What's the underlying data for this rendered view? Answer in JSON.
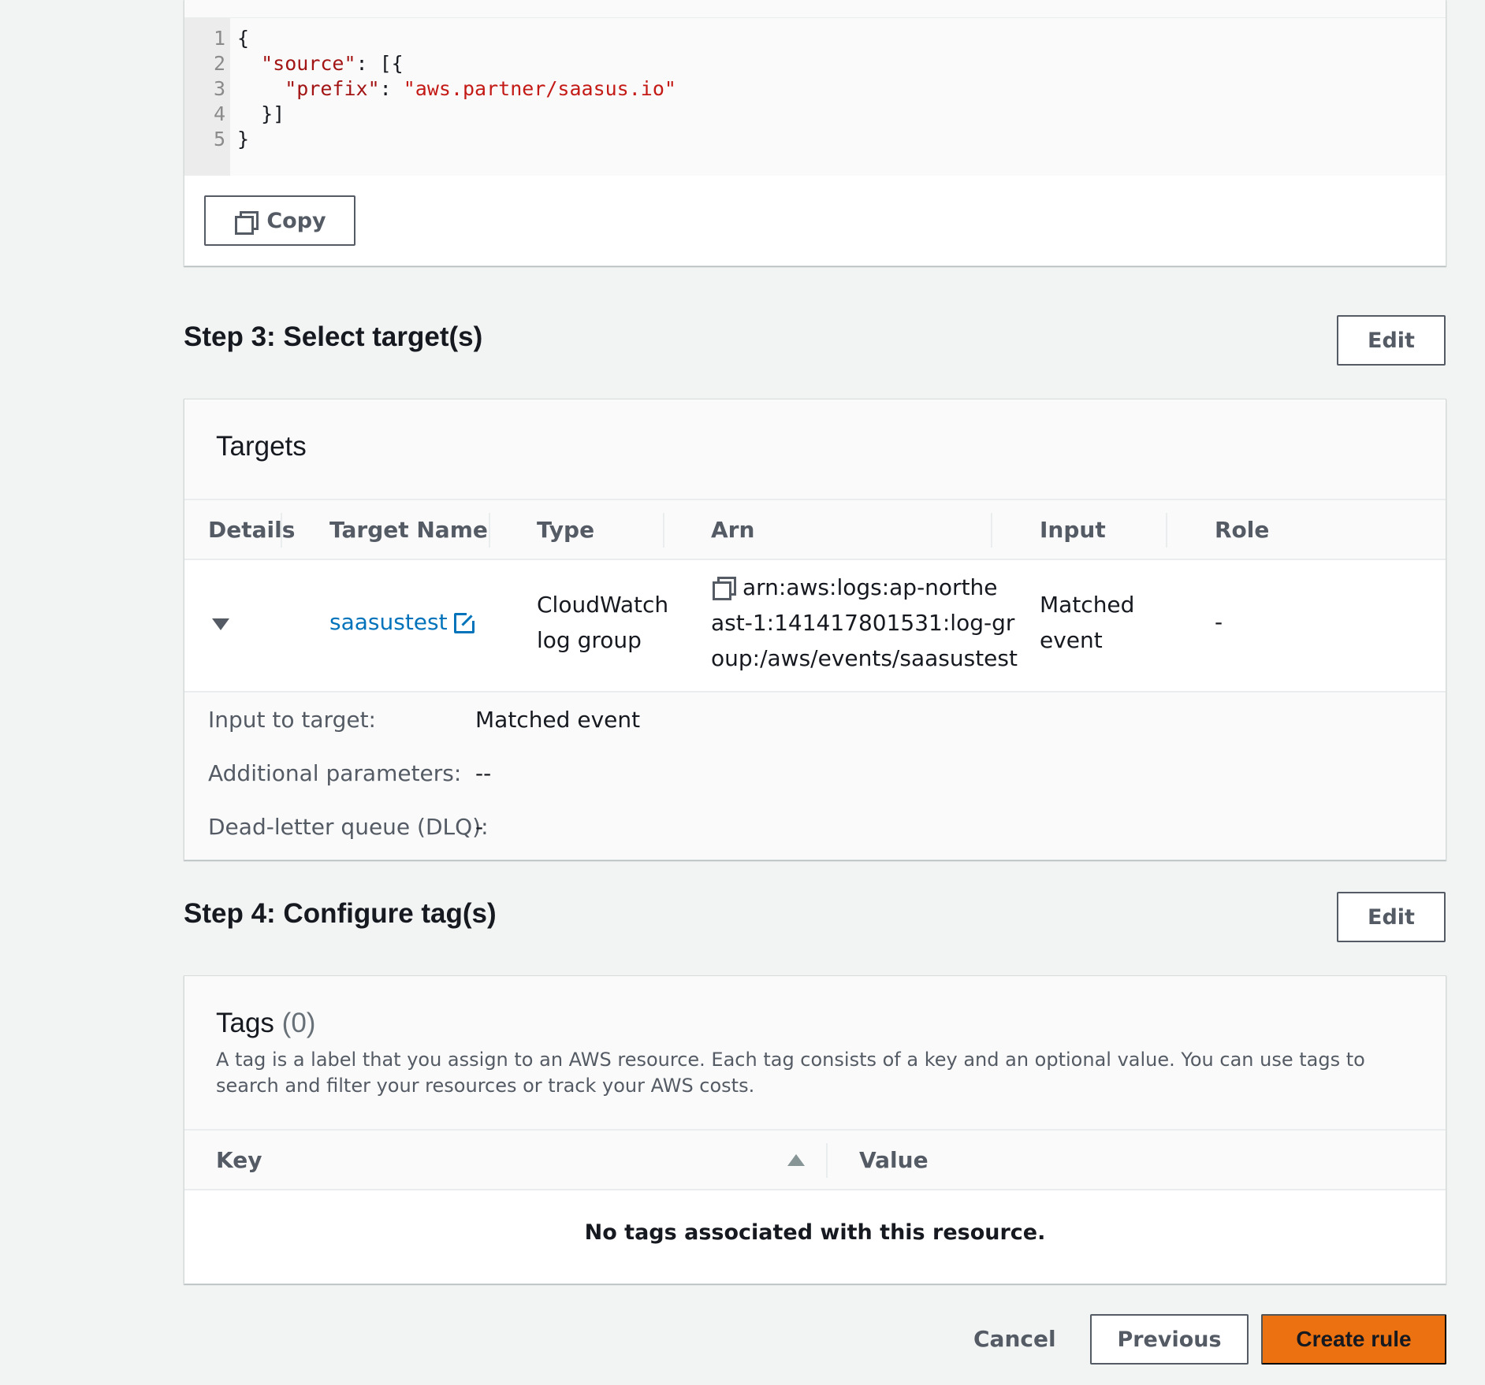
{
  "code_panel": {
    "line_numbers": [
      "1",
      "2",
      "3",
      "4",
      "5"
    ],
    "lines": [
      {
        "parts": [
          {
            "t": "{",
            "c": ""
          }
        ]
      },
      {
        "parts": [
          {
            "t": "  ",
            "c": ""
          },
          {
            "t": "\"source\"",
            "c": "key"
          },
          {
            "t": ": [{",
            "c": ""
          }
        ]
      },
      {
        "parts": [
          {
            "t": "    ",
            "c": ""
          },
          {
            "t": "\"prefix\"",
            "c": "key"
          },
          {
            "t": ": ",
            "c": ""
          },
          {
            "t": "\"aws.partner/saasus.io\"",
            "c": "str"
          }
        ]
      },
      {
        "parts": [
          {
            "t": "  }]",
            "c": ""
          }
        ]
      },
      {
        "parts": [
          {
            "t": "}",
            "c": ""
          }
        ]
      }
    ],
    "copy_label": "Copy"
  },
  "step3": {
    "title": "Step 3: Select target(s)",
    "edit_label": "Edit",
    "panel_title": "Targets",
    "columns": [
      "Details",
      "Target Name",
      "Type",
      "Arn",
      "Input",
      "Role"
    ],
    "row": {
      "target_name": "saasustest",
      "type_line1": "CloudWatch",
      "type_line2": "log group",
      "arn_line1": "arn:aws:logs:ap-northe",
      "arn_line2": "ast-1:141417801531:log-gr",
      "arn_line3": "oup:/aws/events/saasustest",
      "input_line1": "Matched",
      "input_line2": "event",
      "role": "-"
    },
    "details": [
      {
        "label": "Input to target:",
        "value": "Matched event"
      },
      {
        "label": "Additional parameters:",
        "value": "--"
      },
      {
        "label": "Dead-letter queue (DLQ):",
        "value": "-"
      }
    ]
  },
  "step4": {
    "title": "Step 4: Configure tag(s)",
    "edit_label": "Edit",
    "panel_title": "Tags",
    "count": "(0)",
    "description": "A tag is a label that you assign to an AWS resource. Each tag consists of a key and an optional value. You can use tags to search and filter your resources or track your AWS costs.",
    "columns": [
      "Key",
      "Value"
    ],
    "empty_message": "No tags associated with this resource."
  },
  "footer": {
    "cancel_label": "Cancel",
    "previous_label": "Previous",
    "create_label": "Create rule"
  },
  "colors": {
    "primary": "#ec7211",
    "link": "#0073bb",
    "background": "#f2f3f3"
  }
}
